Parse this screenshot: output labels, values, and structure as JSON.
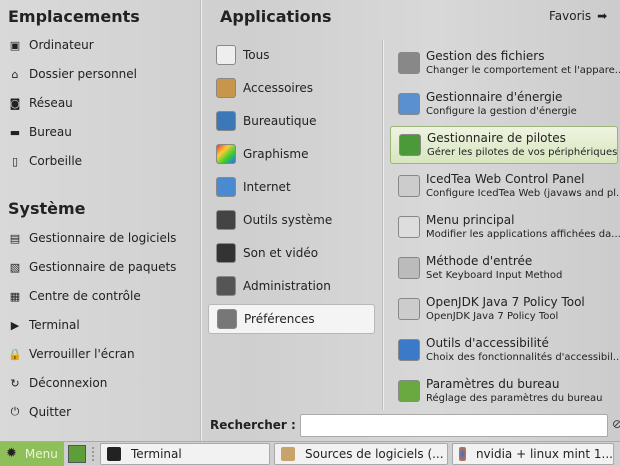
{
  "places": {
    "heading": "Emplacements",
    "items": [
      "Ordinateur",
      "Dossier personnel",
      "Réseau",
      "Bureau",
      "Corbeille"
    ]
  },
  "system": {
    "heading": "Système",
    "items": [
      "Gestionnaire de logiciels",
      "Gestionnaire de paquets",
      "Centre de contrôle",
      "Terminal",
      "Verrouiller l'écran",
      "Déconnexion",
      "Quitter"
    ]
  },
  "applications": {
    "heading": "Applications",
    "favorites": "Favoris",
    "categories": [
      "Tous",
      "Accessoires",
      "Bureautique",
      "Graphisme",
      "Internet",
      "Outils système",
      "Son et vidéo",
      "Administration",
      "Préférences"
    ],
    "apps": [
      {
        "title": "Gestion des fichiers",
        "desc": "Changer le comportement et l'appare..."
      },
      {
        "title": "Gestionnaire d'énergie",
        "desc": "Configure la gestion d'énergie"
      },
      {
        "title": "Gestionnaire de pilotes",
        "desc": "Gérer les pilotes de vos périphériques"
      },
      {
        "title": "IcedTea Web Control Panel",
        "desc": "Configure IcedTea Web (javaws and pl..."
      },
      {
        "title": "Menu principal",
        "desc": "Modifier les applications affichées da..."
      },
      {
        "title": "Méthode d'entrée",
        "desc": "Set Keyboard Input Method"
      },
      {
        "title": "OpenJDK Java 7 Policy Tool",
        "desc": "OpenJDK Java 7 Policy Tool"
      },
      {
        "title": "Outils d'accessibilité",
        "desc": "Choix des fonctionnalités d'accessibil..."
      },
      {
        "title": "Paramètres du bureau",
        "desc": "Réglage des paramètres du bureau"
      }
    ]
  },
  "search": {
    "label": "Rechercher :",
    "value": ""
  },
  "taskbar": {
    "menu": "Menu",
    "windows": [
      "Terminal",
      "Sources de logiciels (...",
      "nvidia + linux mint 1..."
    ]
  }
}
